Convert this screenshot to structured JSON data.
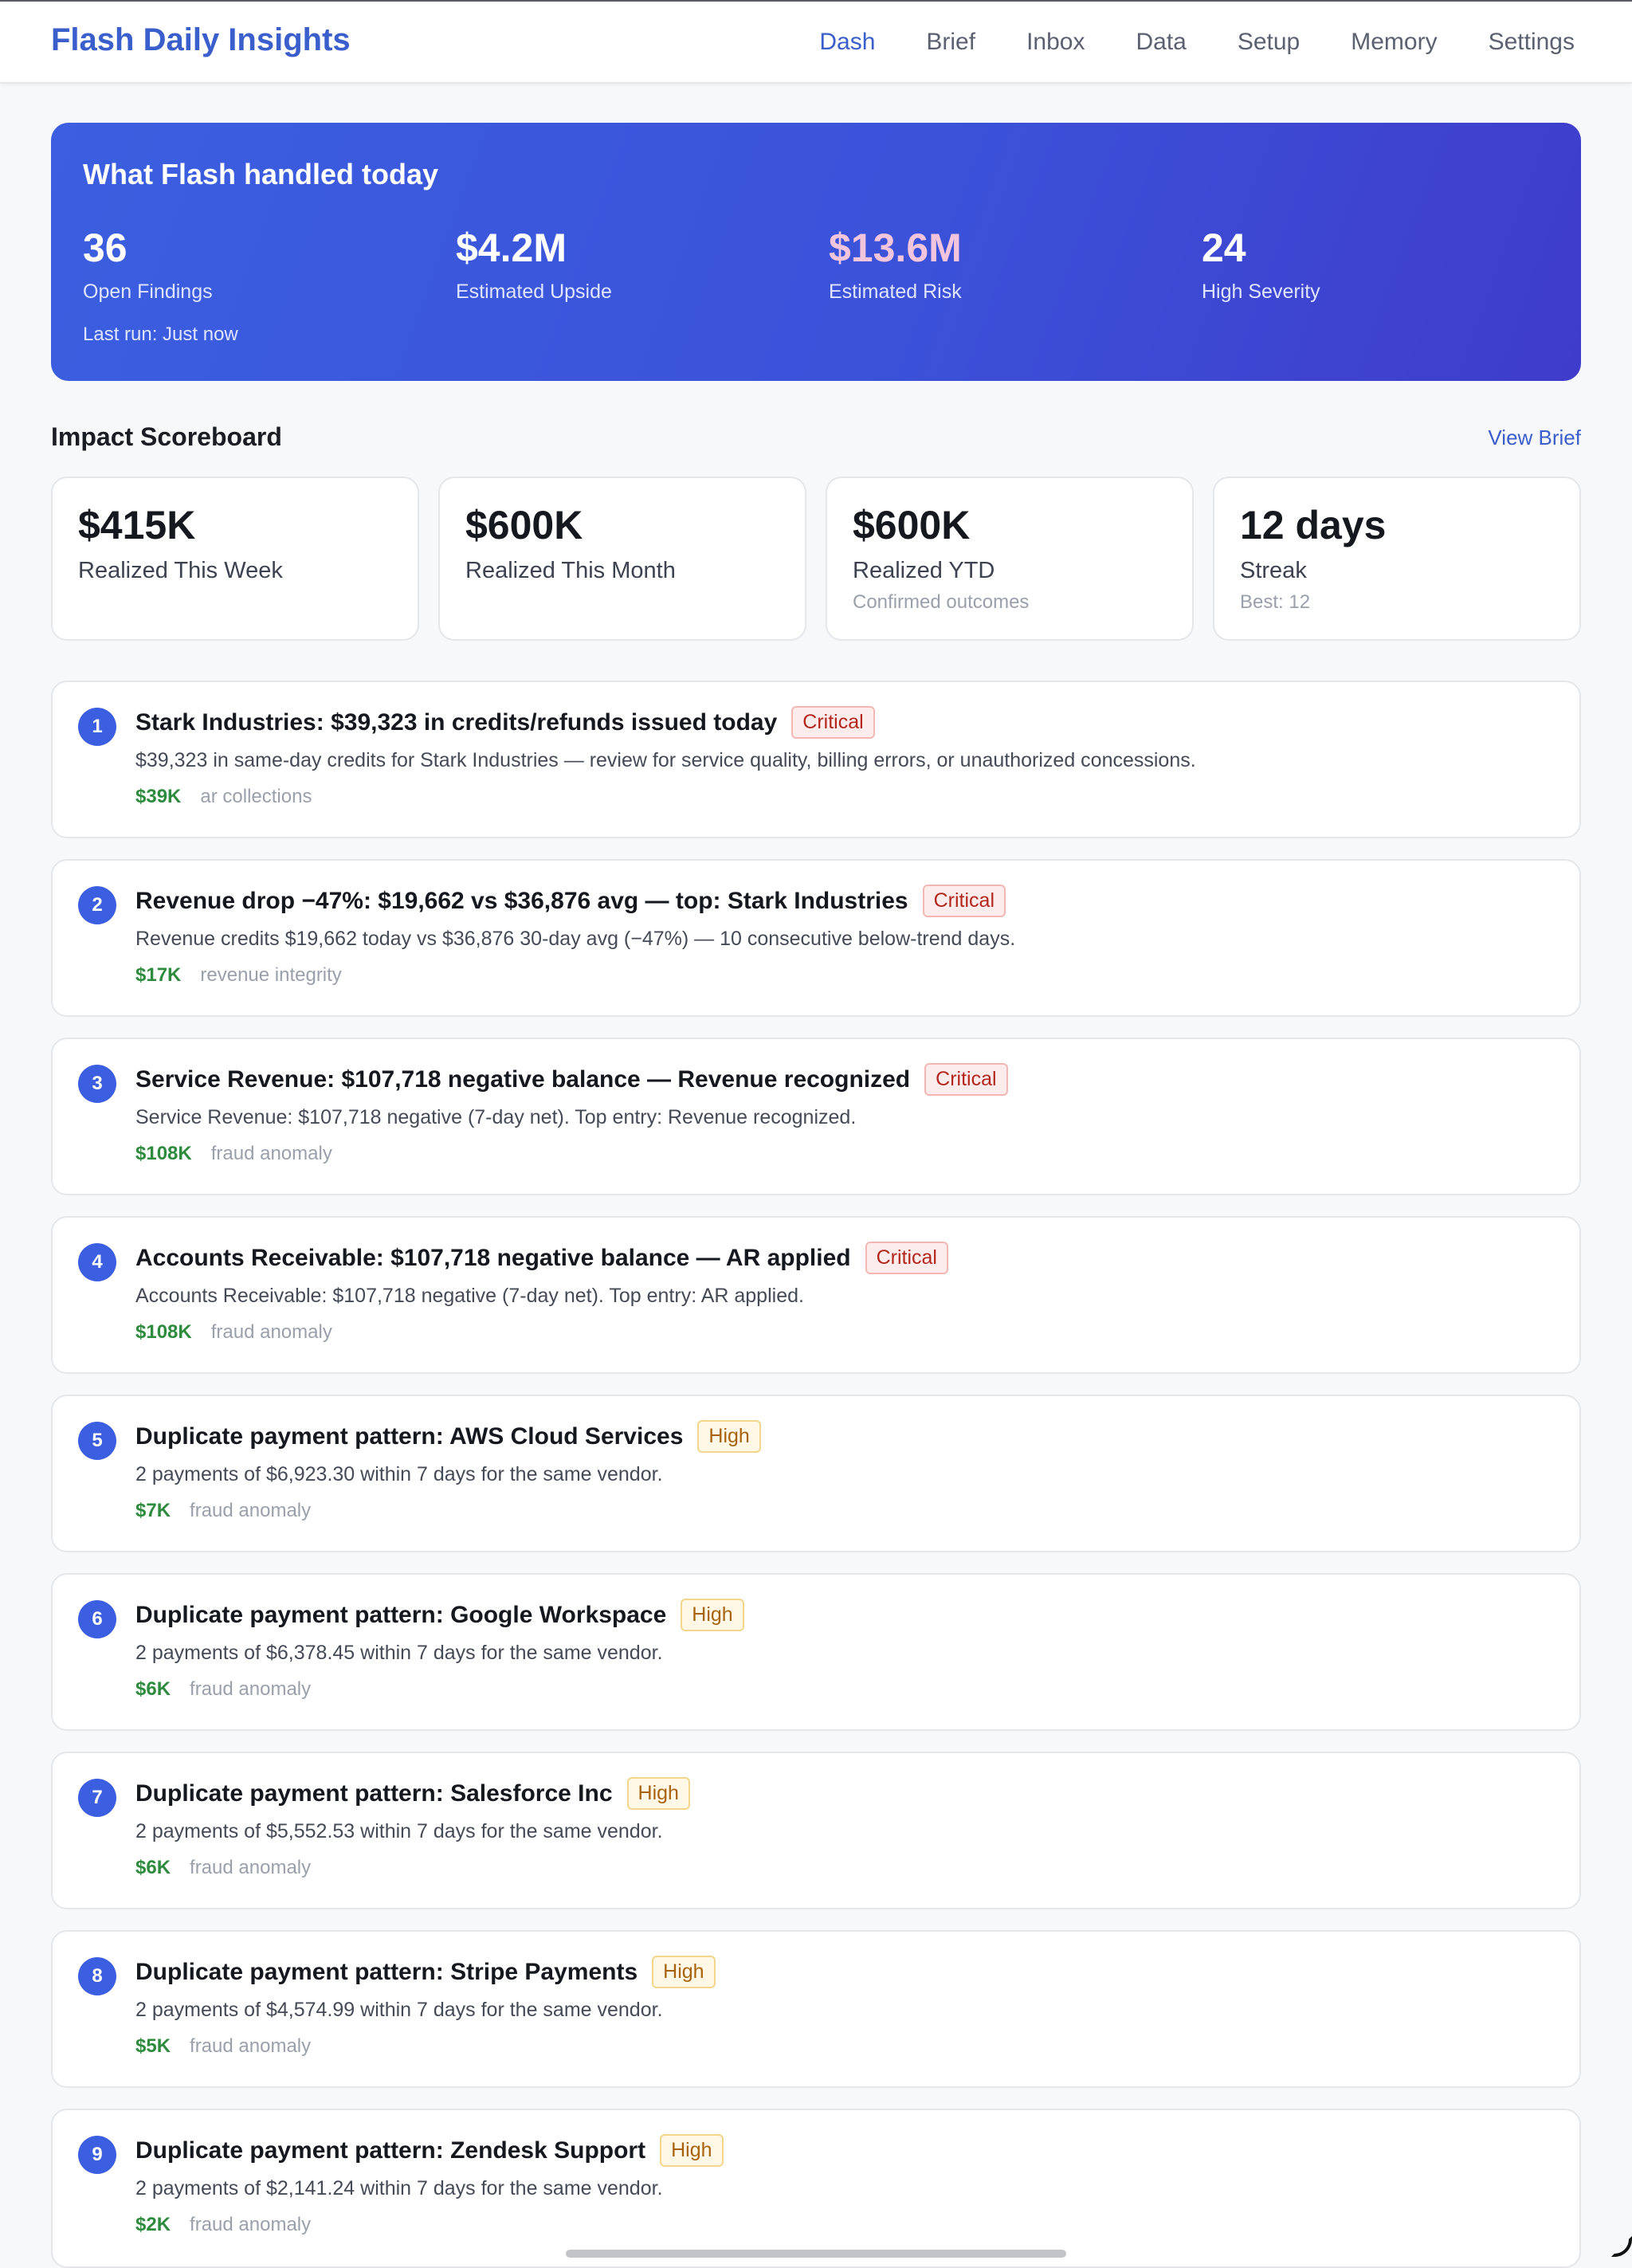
{
  "app": {
    "title": "Flash Daily Insights"
  },
  "nav": {
    "items": [
      {
        "label": "Dash",
        "active": true
      },
      {
        "label": "Brief",
        "active": false
      },
      {
        "label": "Inbox",
        "active": false
      },
      {
        "label": "Data",
        "active": false
      },
      {
        "label": "Setup",
        "active": false
      },
      {
        "label": "Memory",
        "active": false
      },
      {
        "label": "Settings",
        "active": false
      }
    ]
  },
  "hero": {
    "title": "What Flash handled today",
    "stats": [
      {
        "value": "36",
        "label": "Open Findings"
      },
      {
        "value": "$4.2M",
        "label": "Estimated Upside"
      },
      {
        "value": "$13.6M",
        "label": "Estimated Risk"
      },
      {
        "value": "24",
        "label": "High Severity"
      }
    ],
    "last_run": "Last run: Just now"
  },
  "scoreboard": {
    "title": "Impact Scoreboard",
    "link": "View Brief",
    "cards": [
      {
        "value": "$415K",
        "label": "Realized This Week",
        "sub": ""
      },
      {
        "value": "$600K",
        "label": "Realized This Month",
        "sub": ""
      },
      {
        "value": "$600K",
        "label": "Realized YTD",
        "sub": "Confirmed outcomes"
      },
      {
        "value": "12 days",
        "label": "Streak",
        "sub": "Best: 12"
      }
    ]
  },
  "findings": [
    {
      "num": "1",
      "title": "Stark Industries: $39,323 in credits/refunds issued today",
      "severity": "Critical",
      "desc": "$39,323 in same-day credits for Stark Industries — review for service quality, billing errors, or unauthorized concessions.",
      "amount": "$39K",
      "category": "ar collections"
    },
    {
      "num": "2",
      "title": "Revenue drop −47%: $19,662 vs $36,876 avg — top: Stark Industries",
      "severity": "Critical",
      "desc": "Revenue credits $19,662 today vs $36,876 30-day avg (−47%) — 10 consecutive below-trend days.",
      "amount": "$17K",
      "category": "revenue integrity"
    },
    {
      "num": "3",
      "title": "Service Revenue: $107,718 negative balance — Revenue recognized",
      "severity": "Critical",
      "desc": "Service Revenue: $107,718 negative (7-day net). Top entry: Revenue recognized.",
      "amount": "$108K",
      "category": "fraud anomaly"
    },
    {
      "num": "4",
      "title": "Accounts Receivable: $107,718 negative balance — AR applied",
      "severity": "Critical",
      "desc": "Accounts Receivable: $107,718 negative (7-day net). Top entry: AR applied.",
      "amount": "$108K",
      "category": "fraud anomaly"
    },
    {
      "num": "5",
      "title": "Duplicate payment pattern: AWS Cloud Services",
      "severity": "High",
      "desc": "2 payments of $6,923.30 within 7 days for the same vendor.",
      "amount": "$7K",
      "category": "fraud anomaly"
    },
    {
      "num": "6",
      "title": "Duplicate payment pattern: Google Workspace",
      "severity": "High",
      "desc": "2 payments of $6,378.45 within 7 days for the same vendor.",
      "amount": "$6K",
      "category": "fraud anomaly"
    },
    {
      "num": "7",
      "title": "Duplicate payment pattern: Salesforce Inc",
      "severity": "High",
      "desc": "2 payments of $5,552.53 within 7 days for the same vendor.",
      "amount": "$6K",
      "category": "fraud anomaly"
    },
    {
      "num": "8",
      "title": "Duplicate payment pattern: Stripe Payments",
      "severity": "High",
      "desc": "2 payments of $4,574.99 within 7 days for the same vendor.",
      "amount": "$5K",
      "category": "fraud anomaly"
    },
    {
      "num": "9",
      "title": "Duplicate payment pattern: Zendesk Support",
      "severity": "High",
      "desc": "2 payments of $2,141.24 within 7 days for the same vendor.",
      "amount": "$2K",
      "category": "fraud anomaly"
    }
  ],
  "colors": {
    "accent": "#3a5ecb",
    "hero_gradient_start": "#3b5fe0",
    "hero_gradient_end": "#3f3ccb",
    "critical": "#b3261e",
    "high": "#a8620b",
    "amount": "#2e8b3e"
  }
}
